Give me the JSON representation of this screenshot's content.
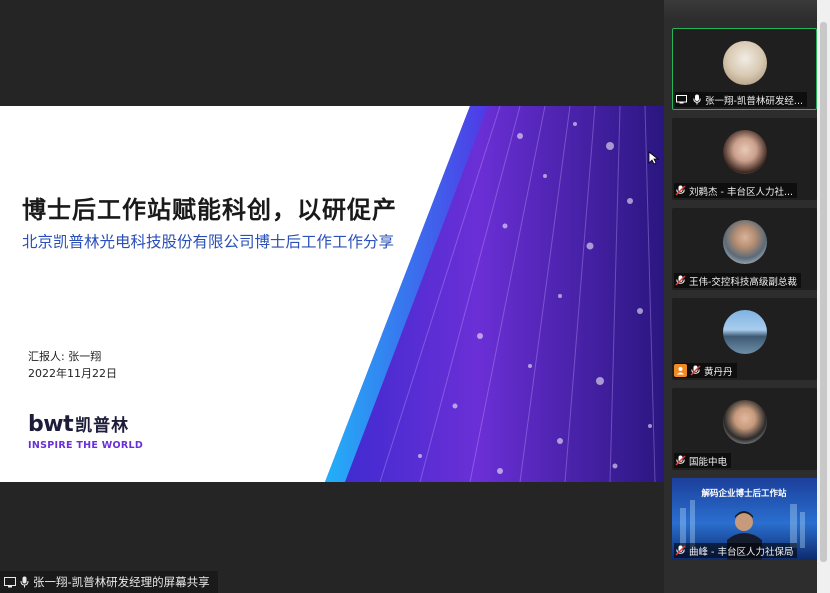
{
  "slide": {
    "title": "博士后工作站赋能科创，以研促产",
    "subtitle": "北京凯普林光电科技股份有限公司博士后工作工作分享",
    "presenter": "汇报人: 张一翔",
    "date": "2022年11月22日",
    "logo_text": "bwt",
    "logo_cn": "凯普林",
    "logo_tagline": "INSPIRE THE WORLD"
  },
  "share_label": "张一翔-凯普林研发经理的屏幕共享",
  "participants": [
    {
      "name": "张一翔-凯普林研发经...",
      "active": true
    },
    {
      "name": "刘鹈杰 - 丰台区人力社..."
    },
    {
      "name": "王伟-交控科技高级副总裁"
    },
    {
      "name": "黄丹丹"
    },
    {
      "name": "国能中电"
    },
    {
      "name": "曲峰 - 丰台区人力社保局",
      "video_banner": "解码企业博士后工作站"
    }
  ],
  "colors": {
    "accent_purple": "#6a2fd8",
    "subtitle_blue": "#2a4fb8",
    "active_border": "#26b55a"
  }
}
